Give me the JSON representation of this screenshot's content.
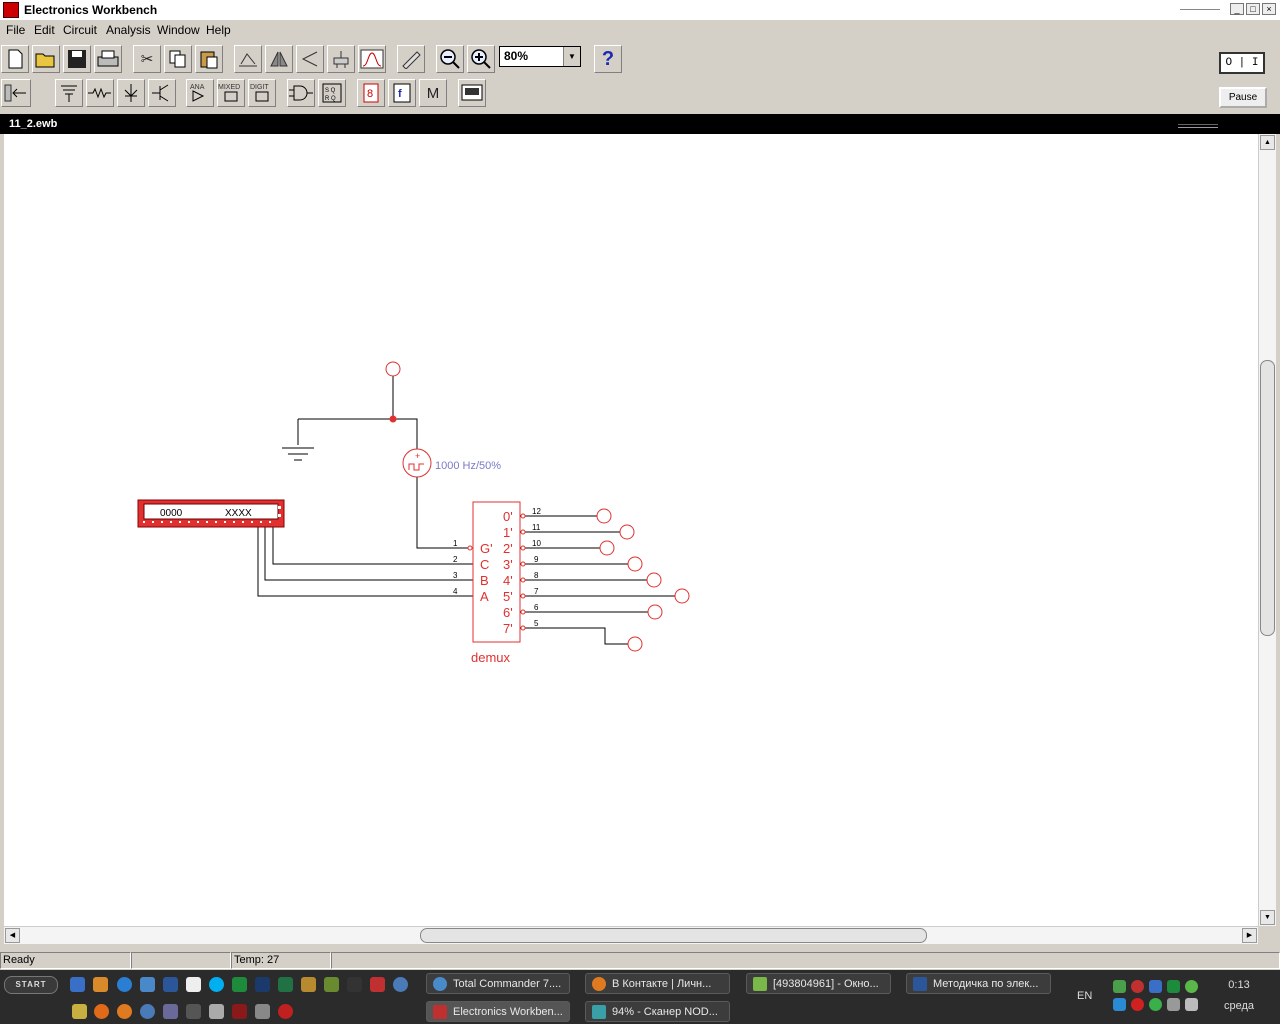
{
  "window": {
    "title": "Electronics Workbench"
  },
  "menu": [
    "File",
    "Edit",
    "Circuit",
    "Analysis",
    "Window",
    "Help"
  ],
  "toolbar": {
    "zoom_value": "80%",
    "help_label": "?",
    "power_label": "O | I",
    "pause_label": "Pause",
    "bin_labels": {
      "analog": "ANA",
      "mixed": "MIXED",
      "digital": "DIGIT",
      "misc": "M"
    }
  },
  "document": {
    "title": "11_2.ewb"
  },
  "circuit": {
    "source_label": "1000 Hz/50%",
    "word_generator": {
      "left_display": "0000",
      "right_display": "XXXX"
    },
    "demux": {
      "name": "demux",
      "inputs": [
        {
          "pin": "1",
          "label": "G'"
        },
        {
          "pin": "2",
          "label": "C"
        },
        {
          "pin": "3",
          "label": "B"
        },
        {
          "pin": "4",
          "label": "A"
        }
      ],
      "outputs": [
        {
          "pin": "12",
          "label": "0'"
        },
        {
          "pin": "11",
          "label": "1'"
        },
        {
          "pin": "10",
          "label": "2'"
        },
        {
          "pin": "9",
          "label": "3'"
        },
        {
          "pin": "8",
          "label": "4'"
        },
        {
          "pin": "7",
          "label": "5'"
        },
        {
          "pin": "6",
          "label": "6'"
        },
        {
          "pin": "5",
          "label": "7'"
        }
      ]
    },
    "colors": {
      "component": "#e03030",
      "wire": "#000000",
      "source_label": "#7a7ac8"
    }
  },
  "status": {
    "main": "Ready",
    "temp": "Temp:  27"
  },
  "taskbar": {
    "start_label": "START",
    "items": [
      "Total Commander 7....",
      "В Контакте | Личн...",
      "[493804961] - Окно...",
      "Методичка по элек...",
      "Electronics Workben...",
      "94% - Сканер NOD..."
    ],
    "lang": "EN",
    "time": "0:13",
    "day": "среда"
  }
}
